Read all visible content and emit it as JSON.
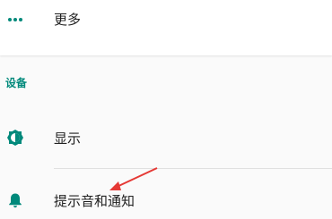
{
  "more_row": {
    "label": "更多",
    "icon": "more-horizontal-icon"
  },
  "device_section": {
    "header": "设备"
  },
  "display_row": {
    "label": "显示",
    "icon": "brightness-icon"
  },
  "notification_row": {
    "label": "提示音和通知",
    "icon": "bell-icon"
  },
  "colors": {
    "accent": "#00897b",
    "arrow": "#e53935"
  }
}
